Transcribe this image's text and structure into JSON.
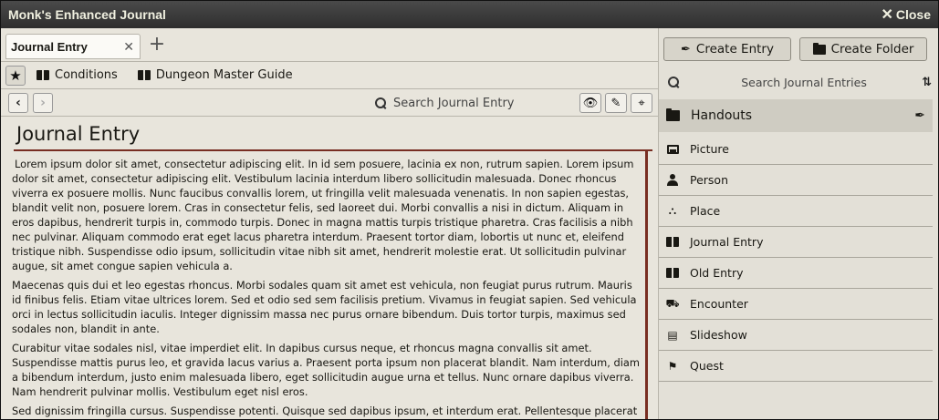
{
  "window": {
    "title": "Monk's Enhanced Journal",
    "close_label": "Close"
  },
  "tabs": [
    {
      "label": "Journal Entry"
    }
  ],
  "bookmarks": [
    {
      "label": "Conditions"
    },
    {
      "label": "Dungeon Master Guide"
    }
  ],
  "toolbar": {
    "search_placeholder": "Search Journal Entry"
  },
  "entry": {
    "title": "Journal Entry",
    "paragraphs": [
      "Lorem ipsum dolor sit amet, consectetur adipiscing elit. In id sem posuere, lacinia ex non, rutrum sapien. Lorem ipsum dolor sit amet, consectetur adipiscing elit. Vestibulum lacinia interdum libero sollicitudin malesuada. Donec rhoncus viverra ex posuere mollis. Nunc faucibus convallis lorem, ut fringilla velit malesuada venenatis. In non sapien egestas, blandit velit non, posuere lorem. Cras in consectetur felis, sed laoreet dui. Morbi convallis a nisi in dictum. Aliquam in eros dapibus, hendrerit turpis in, commodo turpis. Donec in magna mattis turpis tristique pharetra. Cras facilisis a nibh nec pulvinar. Aliquam commodo erat eget lacus pharetra interdum. Praesent tortor diam, lobortis ut nunc et, eleifend tristique nibh. Suspendisse odio ipsum, sollicitudin vitae nibh sit amet, hendrerit molestie erat. Ut sollicitudin pulvinar augue, sit amet congue sapien vehicula a.",
      "Maecenas quis dui et leo egestas rhoncus. Morbi sodales quam sit amet est vehicula, non feugiat purus rutrum. Mauris id finibus felis. Etiam vitae ultrices lorem. Sed et odio sed sem facilisis pretium. Vivamus in feugiat sapien. Sed vehicula orci in lectus sollicitudin iaculis. Integer dignissim massa nec purus ornare bibendum. Duis tortor turpis, maximus sed sodales non, blandit in ante.",
      "Curabitur vitae sodales nisl, vitae imperdiet elit. In dapibus cursus neque, et rhoncus magna convallis sit amet. Suspendisse mattis purus leo, et gravida lacus varius a. Praesent porta ipsum non placerat blandit. Nam interdum, diam a bibendum interdum, justo enim malesuada libero, eget sollicitudin augue urna et tellus. Nunc ornare dapibus viverra. Nam hendrerit pulvinar mollis. Vestibulum eget nisl eros.",
      "Sed dignissim fringilla cursus. Suspendisse potenti. Quisque sed dapibus ipsum, et interdum erat. Pellentesque placerat odio"
    ]
  },
  "sidebar": {
    "create_entry_label": "Create Entry",
    "create_folder_label": "Create Folder",
    "search_placeholder": "Search Journal Entries",
    "folder": {
      "label": "Handouts"
    },
    "entries": [
      {
        "label": "Picture",
        "icon": "image-icon"
      },
      {
        "label": "Person",
        "icon": "person-icon"
      },
      {
        "label": "Place",
        "icon": "place-icon"
      },
      {
        "label": "Journal Entry",
        "icon": "book-icon"
      },
      {
        "label": "Old Entry",
        "icon": "book-icon"
      },
      {
        "label": "Encounter",
        "icon": "encounter-icon"
      },
      {
        "label": "Slideshow",
        "icon": "slideshow-icon"
      },
      {
        "label": "Quest",
        "icon": "signpost-icon"
      }
    ]
  },
  "colors": {
    "accent_rule": "#782e22",
    "titlebar": "#3a3a3a",
    "paper": "#e8e5dc"
  }
}
